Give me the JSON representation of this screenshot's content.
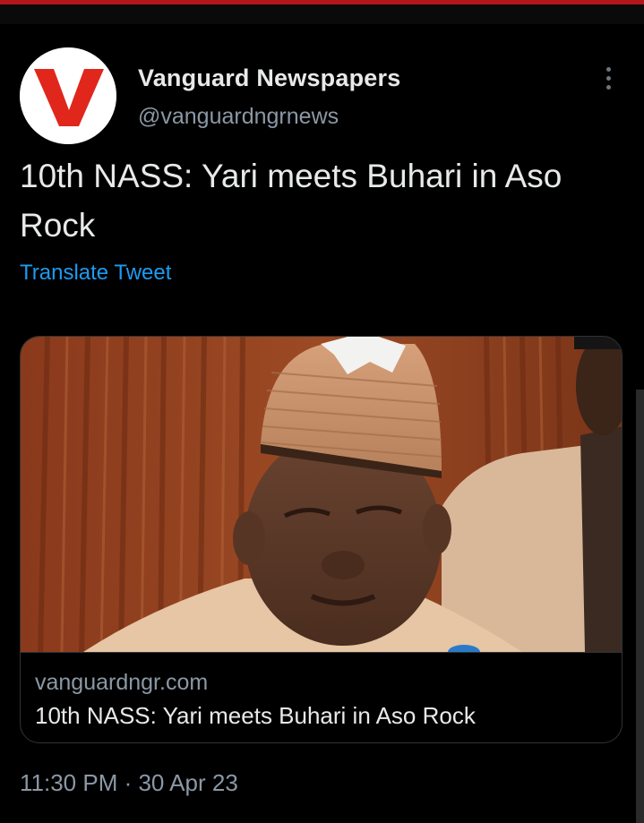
{
  "tweet": {
    "author_name": "Vanguard Newspapers",
    "author_handle": "@vanguardngrnews",
    "text": "10th NASS: Yari meets Buhari in Aso Rock",
    "translate_label": "Translate Tweet",
    "timestamp": "11:30 PM · 30 Apr 23",
    "avatar_letter": "V"
  },
  "link_card": {
    "domain": "vanguardngr.com",
    "title": "10th NASS: Yari meets Buhari in Aso Rock"
  },
  "icons": {
    "more": "more-options-icon",
    "avatar": "vanguard-logo"
  },
  "colors": {
    "background": "#000000",
    "brand_red": "#e1261c",
    "link_blue": "#1d9bf0",
    "text_primary": "#e7e9ea",
    "text_secondary": "#8b98a5"
  }
}
